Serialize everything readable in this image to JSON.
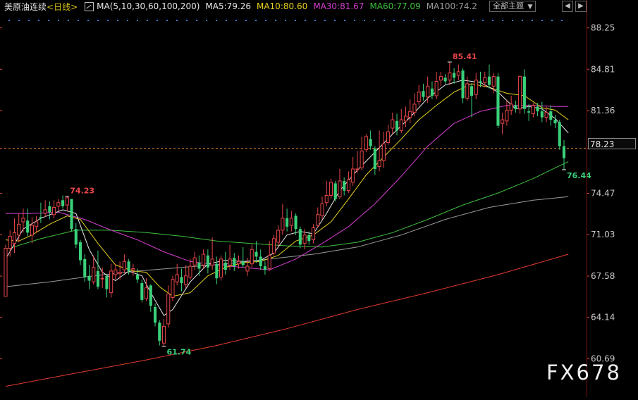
{
  "header": {
    "symbol": "美原油连续",
    "period": "<日线>",
    "ma_spec": "MA(5,10,30,60,100,200)",
    "ma_values": [
      {
        "label": "MA5:79.26",
        "color": "#e8e8e8"
      },
      {
        "label": "MA10:80.60",
        "color": "#e6d21e"
      },
      {
        "label": "MA30:81.67",
        "color": "#d73fd2"
      },
      {
        "label": "MA60:77.09",
        "color": "#3fbf3f"
      },
      {
        "label": "MA100:74.2",
        "color": "#9a9a9a"
      }
    ],
    "theme_button": "全部主题",
    "theme_arrow": "▼",
    "nav_left": "◀",
    "nav_right": "▶"
  },
  "price_label": "78.23",
  "watermark": "FX678",
  "colors": {
    "up": "#e8464a",
    "down": "#3ad07a",
    "background": "#000000",
    "axis_text": "#c8c8c8",
    "axis_red": "#e04646",
    "dashed": "#c87828",
    "ma5": "#e8e8e8",
    "ma10": "#e6d21e",
    "ma30": "#d73fd2",
    "ma60": "#3fbf3f",
    "ma100": "#9a9a9a",
    "ma200": "#e43a2e"
  },
  "chart_data": {
    "type": "candlestick",
    "y_ticks": [
      88.25,
      84.81,
      81.36,
      78.23,
      74.47,
      71.03,
      67.58,
      64.14,
      60.69
    ],
    "ylim": [
      58.2,
      89.4
    ],
    "current_price": 78.23,
    "annotations": [
      {
        "text": "74.23",
        "value": 74.23,
        "type": "high",
        "index": 14
      },
      {
        "text": "61.74",
        "value": 61.74,
        "type": "low",
        "index": 36
      },
      {
        "text": "85.41",
        "value": 85.41,
        "type": "high",
        "index": 101
      },
      {
        "text": "76.44",
        "value": 76.44,
        "type": "low",
        "index": 127
      }
    ],
    "ohlc": [
      [
        65.9,
        69.9,
        65.9,
        70.2
      ],
      [
        69.9,
        70.9,
        69.2,
        71.4
      ],
      [
        70.3,
        71.2,
        69.5,
        72.4
      ],
      [
        71.0,
        71.9,
        70.4,
        72.8
      ],
      [
        72.1,
        72.4,
        71.2,
        73.2
      ],
      [
        72.2,
        71.2,
        70.9,
        73.2
      ],
      [
        71.0,
        71.8,
        70.3,
        72.5
      ],
      [
        71.7,
        72.1,
        71.2,
        72.6
      ],
      [
        72.5,
        72.4,
        72.0,
        73.7
      ],
      [
        72.8,
        73.1,
        72.5,
        73.9
      ],
      [
        73.4,
        72.9,
        72.3,
        73.8
      ],
      [
        72.7,
        73.3,
        72.4,
        73.9
      ],
      [
        73.4,
        73.7,
        73.0,
        74.0
      ],
      [
        73.9,
        73.4,
        73.2,
        74.3
      ],
      [
        73.5,
        74.1,
        73.0,
        74.2
      ],
      [
        74.0,
        71.5,
        71.3,
        74.0
      ],
      [
        71.5,
        70.2,
        69.9,
        72.0
      ],
      [
        70.4,
        68.9,
        68.5,
        70.6
      ],
      [
        69.0,
        67.5,
        67.1,
        69.4
      ],
      [
        67.6,
        67.2,
        66.5,
        68.5
      ],
      [
        67.1,
        68.3,
        66.9,
        69.3
      ],
      [
        68.0,
        66.7,
        66.5,
        69.7
      ],
      [
        67.4,
        67.4,
        66.6,
        68.3
      ],
      [
        67.6,
        66.5,
        65.8,
        67.7
      ],
      [
        66.2,
        68.0,
        65.8,
        68.6
      ],
      [
        67.7,
        68.1,
        67.3,
        68.6
      ],
      [
        67.8,
        67.9,
        67.3,
        68.8
      ],
      [
        68.1,
        68.8,
        67.8,
        69.4
      ],
      [
        68.8,
        68.0,
        67.7,
        69.0
      ],
      [
        68.1,
        68.2,
        67.6,
        68.6
      ],
      [
        67.7,
        67.3,
        67.0,
        68.2
      ],
      [
        67.0,
        65.6,
        65.4,
        67.3
      ],
      [
        65.7,
        66.6,
        65.5,
        67.4
      ],
      [
        66.8,
        65.1,
        64.6,
        66.9
      ],
      [
        65.0,
        63.7,
        63.4,
        65.3
      ],
      [
        63.7,
        62.2,
        61.8,
        63.9
      ],
      [
        62.0,
        63.4,
        61.7,
        64.0
      ],
      [
        63.6,
        66.1,
        63.3,
        66.8
      ],
      [
        65.8,
        67.3,
        65.5,
        67.6
      ],
      [
        67.1,
        67.7,
        66.8,
        68.6
      ],
      [
        67.5,
        67.0,
        66.3,
        68.2
      ],
      [
        66.9,
        67.6,
        66.6,
        68.5
      ],
      [
        67.5,
        68.4,
        67.3,
        69.0
      ],
      [
        68.5,
        69.1,
        68.1,
        69.6
      ],
      [
        68.7,
        68.2,
        67.6,
        69.3
      ],
      [
        68.5,
        69.4,
        68.2,
        69.8
      ],
      [
        69.3,
        68.3,
        67.8,
        69.8
      ],
      [
        68.5,
        69.0,
        68.1,
        70.8
      ],
      [
        68.6,
        67.4,
        66.9,
        69.2
      ],
      [
        67.5,
        69.0,
        67.2,
        69.3
      ],
      [
        68.7,
        68.1,
        67.7,
        69.6
      ],
      [
        68.5,
        69.0,
        68.1,
        70.2
      ],
      [
        69.1,
        68.4,
        68.0,
        69.5
      ],
      [
        68.6,
        68.8,
        68.2,
        69.3
      ],
      [
        68.8,
        68.5,
        68.3,
        70.0
      ],
      [
        68.0,
        68.4,
        67.6,
        69.1
      ],
      [
        68.6,
        69.8,
        68.3,
        70.2
      ],
      [
        69.6,
        69.2,
        68.7,
        70.5
      ],
      [
        69.2,
        68.4,
        68.1,
        69.8
      ],
      [
        68.4,
        68.1,
        67.7,
        68.8
      ],
      [
        68.2,
        69.3,
        68.0,
        70.5
      ],
      [
        69.5,
        70.7,
        69.3,
        71.0
      ],
      [
        70.4,
        71.4,
        70.0,
        71.8
      ],
      [
        71.4,
        72.4,
        71.0,
        73.6
      ],
      [
        72.4,
        71.7,
        71.3,
        73.2
      ],
      [
        71.8,
        72.4,
        71.3,
        73.0
      ],
      [
        72.6,
        71.5,
        71.0,
        72.8
      ],
      [
        71.5,
        70.2,
        69.9,
        71.7
      ],
      [
        70.3,
        71.0,
        69.8,
        71.5
      ],
      [
        71.0,
        70.5,
        70.2,
        71.3
      ],
      [
        70.6,
        71.6,
        70.3,
        71.9
      ],
      [
        71.8,
        72.7,
        71.6,
        73.3
      ],
      [
        72.6,
        73.6,
        72.3,
        74.2
      ],
      [
        73.7,
        74.3,
        73.4,
        75.5
      ],
      [
        74.3,
        75.4,
        74.0,
        75.7
      ],
      [
        75.3,
        74.0,
        73.8,
        75.5
      ],
      [
        74.2,
        75.5,
        74.0,
        76.5
      ],
      [
        75.5,
        74.7,
        74.3,
        75.8
      ],
      [
        74.7,
        75.6,
        74.5,
        76.3
      ],
      [
        75.4,
        76.5,
        75.1,
        77.5
      ],
      [
        76.5,
        76.5,
        76.2,
        78.0
      ],
      [
        76.6,
        78.0,
        76.4,
        79.2
      ],
      [
        78.1,
        79.2,
        77.9,
        79.4
      ],
      [
        79.0,
        78.4,
        78.1,
        79.7
      ],
      [
        78.2,
        76.5,
        76.0,
        78.4
      ],
      [
        76.7,
        77.2,
        76.3,
        79.7
      ],
      [
        77.2,
        78.6,
        76.6,
        79.6
      ],
      [
        78.7,
        79.6,
        78.5,
        80.2
      ],
      [
        79.9,
        80.6,
        79.4,
        81.2
      ],
      [
        80.5,
        79.7,
        79.3,
        81.1
      ],
      [
        79.7,
        80.6,
        79.5,
        81.5
      ],
      [
        80.5,
        80.9,
        80.0,
        81.7
      ],
      [
        80.8,
        81.3,
        80.3,
        82.3
      ],
      [
        81.2,
        81.9,
        80.9,
        82.8
      ],
      [
        82.1,
        82.9,
        81.8,
        83.5
      ],
      [
        83.0,
        82.5,
        82.2,
        83.6
      ],
      [
        82.5,
        83.4,
        82.0,
        84.2
      ],
      [
        83.2,
        82.6,
        82.3,
        83.8
      ],
      [
        82.6,
        83.8,
        82.3,
        84.6
      ],
      [
        83.9,
        84.2,
        83.4,
        84.6
      ],
      [
        84.1,
        83.8,
        83.6,
        84.4
      ],
      [
        83.9,
        84.5,
        83.5,
        85.4
      ],
      [
        84.5,
        84.1,
        83.6,
        84.9
      ],
      [
        84.3,
        84.6,
        83.9,
        85.2
      ],
      [
        84.7,
        82.4,
        82.0,
        84.9
      ],
      [
        82.4,
        83.6,
        82.2,
        84.2
      ],
      [
        83.4,
        82.6,
        80.8,
        83.6
      ],
      [
        82.7,
        83.9,
        82.3,
        84.5
      ],
      [
        83.8,
        83.7,
        83.3,
        84.6
      ],
      [
        83.7,
        84.1,
        83.3,
        84.6
      ],
      [
        84.2,
        83.5,
        83.2,
        85.2
      ],
      [
        83.4,
        84.2,
        82.8,
        84.5
      ],
      [
        84.2,
        80.1,
        79.9,
        84.5
      ],
      [
        80.3,
        80.6,
        79.4,
        81.2
      ],
      [
        80.5,
        81.4,
        80.1,
        82.2
      ],
      [
        81.4,
        81.9,
        81.0,
        82.6
      ],
      [
        81.8,
        81.5,
        81.2,
        82.2
      ],
      [
        81.5,
        84.2,
        81.1,
        84.3
      ],
      [
        84.2,
        81.5,
        81.1,
        84.8
      ],
      [
        81.3,
        81.2,
        80.5,
        81.9
      ],
      [
        81.1,
        81.8,
        80.8,
        82.0
      ],
      [
        81.7,
        81.3,
        80.9,
        82.0
      ],
      [
        81.3,
        80.8,
        80.4,
        82.1
      ],
      [
        80.8,
        81.2,
        80.4,
        81.7
      ],
      [
        81.3,
        80.6,
        80.1,
        81.8
      ],
      [
        80.6,
        80.3,
        79.9,
        81.0
      ],
      [
        80.4,
        78.4,
        78.1,
        80.6
      ],
      [
        78.4,
        77.4,
        76.4,
        78.9
      ]
    ],
    "series": [
      {
        "name": "MA5",
        "color_key": "ma5",
        "x": [
          0,
          4,
          8,
          13,
          16,
          19,
          22,
          25,
          28,
          31,
          33,
          36,
          38,
          42,
          46,
          50,
          54,
          58,
          61,
          64,
          67,
          70,
          73,
          76,
          80,
          84,
          88,
          92,
          96,
          100,
          104,
          108,
          112,
          116,
          119,
          122,
          125,
          128
        ],
        "y": [
          69.0,
          71.5,
          72.4,
          73.1,
          72.8,
          69.8,
          67.9,
          67.2,
          68.0,
          67.6,
          66.2,
          64.3,
          64.8,
          67.1,
          68.6,
          68.9,
          68.8,
          68.9,
          69.5,
          71.0,
          71.3,
          71.1,
          72.8,
          74.7,
          76.4,
          77.9,
          79.4,
          80.8,
          82.4,
          83.5,
          83.9,
          83.7,
          82.9,
          81.5,
          81.7,
          81.5,
          80.7,
          79.5
        ]
      },
      {
        "name": "MA10",
        "color_key": "ma10",
        "x": [
          0,
          3,
          6,
          10,
          14,
          17,
          21,
          25,
          29,
          32,
          35,
          38,
          42,
          46,
          50,
          54,
          58,
          62,
          66,
          70,
          74,
          78,
          82,
          86,
          90,
          94,
          98,
          102,
          106,
          110,
          114,
          118,
          122,
          125,
          128
        ],
        "y": [
          70.6,
          70.5,
          71.0,
          71.9,
          72.6,
          72.3,
          70.3,
          68.5,
          68.0,
          67.9,
          66.7,
          65.9,
          66.2,
          67.6,
          68.3,
          68.7,
          68.8,
          69.3,
          70.5,
          71.0,
          72.1,
          74.0,
          76.0,
          77.5,
          79.0,
          80.6,
          81.8,
          82.9,
          83.6,
          83.3,
          82.8,
          82.6,
          81.6,
          81.4,
          80.6
        ]
      },
      {
        "name": "MA30",
        "color_key": "ma30",
        "x": [
          0,
          6,
          12,
          18,
          24,
          30,
          36,
          42,
          48,
          54,
          60,
          66,
          72,
          78,
          84,
          90,
          96,
          102,
          108,
          114,
          120,
          125,
          128
        ],
        "y": [
          72.8,
          72.8,
          72.9,
          72.3,
          71.4,
          70.6,
          69.6,
          68.8,
          68.5,
          68.3,
          68.1,
          69.0,
          70.3,
          71.7,
          73.6,
          75.9,
          78.4,
          80.3,
          81.3,
          81.8,
          81.8,
          81.7,
          81.7
        ]
      },
      {
        "name": "MA60",
        "color_key": "ma60",
        "x": [
          0,
          8,
          16,
          24,
          32,
          40,
          48,
          56,
          64,
          72,
          80,
          88,
          96,
          104,
          112,
          120,
          125,
          128
        ],
        "y": [
          69.8,
          70.7,
          71.4,
          71.4,
          71.2,
          70.9,
          70.5,
          70.3,
          70.1,
          70.0,
          70.4,
          71.2,
          72.3,
          73.5,
          74.5,
          75.7,
          76.6,
          77.1
        ]
      },
      {
        "name": "MA100",
        "color_key": "ma100",
        "x": [
          0,
          10,
          20,
          30,
          40,
          50,
          60,
          70,
          80,
          90,
          100,
          110,
          120,
          128
        ],
        "y": [
          66.7,
          67.1,
          67.6,
          68.0,
          68.3,
          68.6,
          69.0,
          69.4,
          70.0,
          71.0,
          72.3,
          73.3,
          73.9,
          74.2
        ]
      },
      {
        "name": "MA200",
        "color_key": "ma200",
        "x": [
          0,
          16,
          32,
          48,
          64,
          80,
          96,
          112,
          128
        ],
        "y": [
          58.4,
          59.5,
          60.6,
          61.8,
          63.2,
          64.8,
          66.2,
          67.7,
          69.4
        ]
      }
    ]
  }
}
